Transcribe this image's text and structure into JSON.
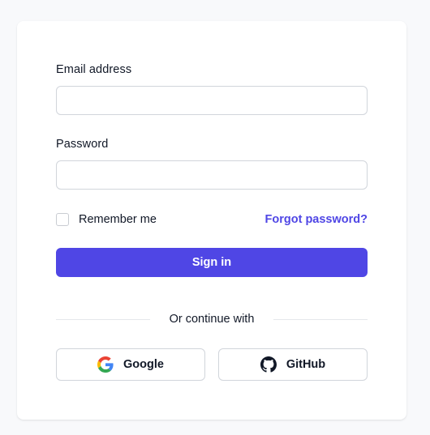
{
  "form": {
    "email_label": "Email address",
    "email_value": "",
    "email_placeholder": "",
    "password_label": "Password",
    "password_value": "",
    "password_placeholder": "",
    "remember_label": "Remember me",
    "remember_checked": false,
    "forgot_label": "Forgot password?",
    "signin_label": "Sign in"
  },
  "divider": {
    "text": "Or continue with"
  },
  "social": [
    {
      "label": "Google",
      "icon": "google-icon"
    },
    {
      "label": "GitHub",
      "icon": "github-icon"
    }
  ],
  "colors": {
    "background": "#f8f9fb",
    "card": "#ffffff",
    "accent": "#4f46e5",
    "border": "#d1d5db",
    "text": "#111827"
  }
}
